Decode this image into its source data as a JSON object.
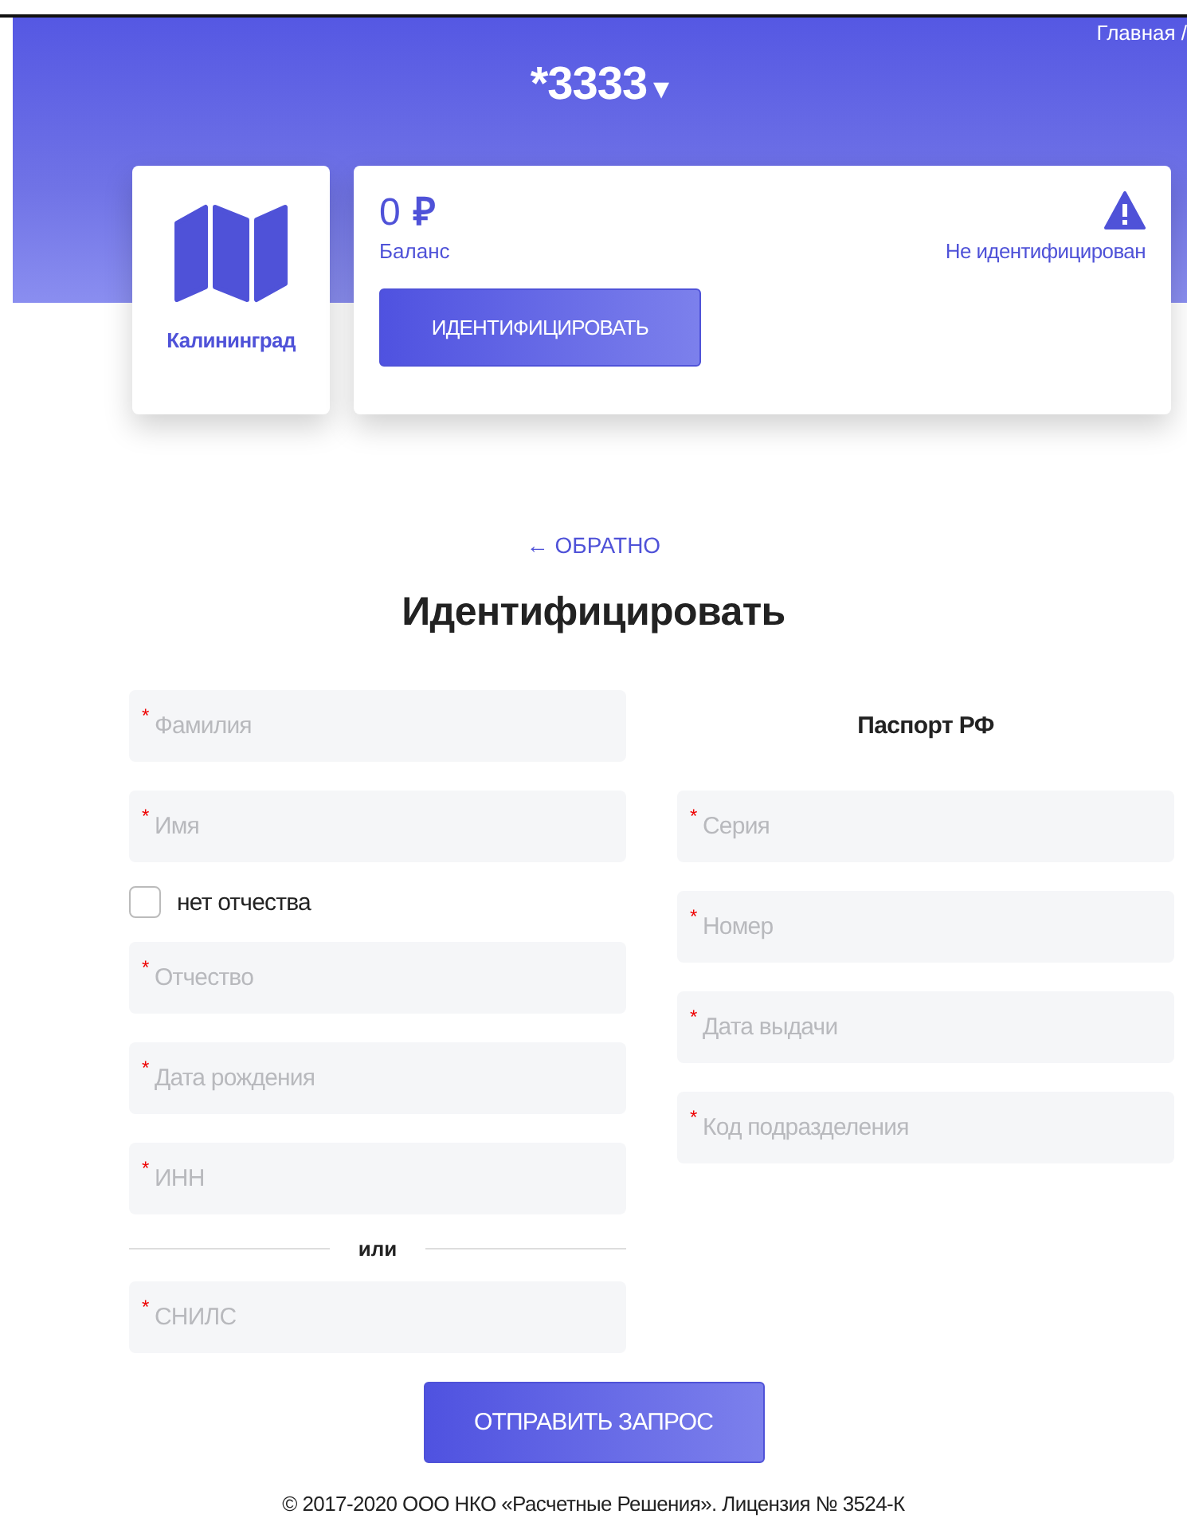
{
  "breadcrumb": "Главная /",
  "account": {
    "title": "*3333",
    "dropdown": "▾"
  },
  "city": {
    "name": "Калининград"
  },
  "balance": {
    "amount": "0",
    "currency": "₽",
    "label": "Баланс",
    "status": "Не идентифицирован",
    "button": "ИДЕНТИФИЦИРОВАТЬ"
  },
  "back_link": {
    "arrow": "←",
    "label": "ОБРАТНО"
  },
  "heading": "Идентифицировать",
  "left_fields": [
    {
      "kind": "field",
      "placeholder": "Фамилия",
      "required_mark": "*"
    },
    {
      "kind": "field",
      "placeholder": "Имя",
      "required_mark": "*"
    },
    {
      "kind": "checkbox",
      "label": "нет отчества",
      "checked": false
    },
    {
      "kind": "field",
      "placeholder": "Отчество",
      "required_mark": "*"
    },
    {
      "kind": "field",
      "placeholder": "Дата рождения",
      "required_mark": "*"
    },
    {
      "kind": "field",
      "placeholder": "ИНН",
      "required_mark": "*"
    },
    {
      "kind": "divider",
      "label": "или"
    },
    {
      "kind": "field",
      "placeholder": "СНИЛС",
      "required_mark": "*"
    }
  ],
  "passport": {
    "title": "Паспорт РФ",
    "fields": [
      {
        "placeholder": "Серия",
        "required_mark": "*"
      },
      {
        "placeholder": "Номер",
        "required_mark": "*"
      },
      {
        "placeholder": "Дата выдачи",
        "required_mark": "*"
      },
      {
        "placeholder": "Код подразделения",
        "required_mark": "*"
      }
    ]
  },
  "submit": "ОТПРАВИТЬ ЗАПРОС",
  "footer": "© 2017-2020 ООО НКО «Расчетные Решения». Лицензия № 3524-К"
}
